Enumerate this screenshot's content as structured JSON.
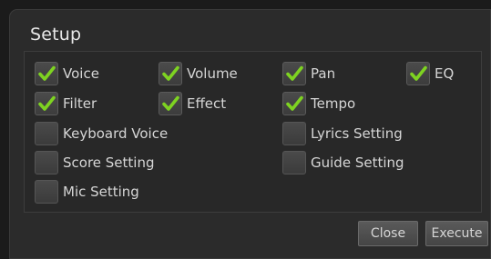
{
  "dialog": {
    "title": "Setup"
  },
  "options": [
    {
      "label": "Voice",
      "checked": true
    },
    {
      "label": "Volume",
      "checked": true
    },
    {
      "label": "Pan",
      "checked": true
    },
    {
      "label": "EQ",
      "checked": true
    },
    {
      "label": "Filter",
      "checked": true
    },
    {
      "label": "Effect",
      "checked": true
    },
    {
      "label": "Tempo",
      "checked": true
    },
    {
      "label": "Keyboard Voice",
      "checked": false
    },
    {
      "label": "Lyrics Setting",
      "checked": false
    },
    {
      "label": "Score Setting",
      "checked": false
    },
    {
      "label": "Guide Setting",
      "checked": false
    },
    {
      "label": "Mic Setting",
      "checked": false
    }
  ],
  "buttons": {
    "close_label": "Close",
    "execute_label": "Execute"
  },
  "colors": {
    "check_green": "#7ed321",
    "background": "#1b1b1b",
    "dialog": "#2b2b2b"
  },
  "icons": {
    "checked": "checkmark-icon"
  }
}
